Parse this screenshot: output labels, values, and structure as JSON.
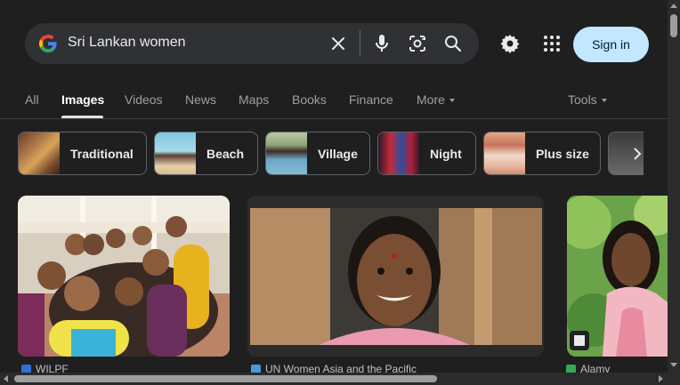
{
  "search": {
    "query": "Sri Lankan women",
    "clear_label": "Clear",
    "voice_label": "Search by voice",
    "lens_label": "Search by image",
    "submit_label": "Search"
  },
  "header": {
    "settings_label": "Settings",
    "apps_label": "Google apps",
    "signin_label": "Sign in"
  },
  "tabs": [
    {
      "label": "All"
    },
    {
      "label": "Images"
    },
    {
      "label": "Videos"
    },
    {
      "label": "News"
    },
    {
      "label": "Maps"
    },
    {
      "label": "Books"
    },
    {
      "label": "Finance"
    },
    {
      "label": "More"
    }
  ],
  "tools_label": "Tools",
  "chips": [
    {
      "label": "Traditional"
    },
    {
      "label": "Beach"
    },
    {
      "label": "Village"
    },
    {
      "label": "Night"
    },
    {
      "label": "Plus size"
    }
  ],
  "results": [
    {
      "source": "WILPF"
    },
    {
      "source": "UN Women Asia and the Pacific"
    },
    {
      "source": "Alamy"
    }
  ],
  "colors": {
    "background": "#1f1f1f",
    "searchbox": "#303134",
    "signin_bg": "#c2e7ff",
    "chip_border": "#5f6368"
  }
}
